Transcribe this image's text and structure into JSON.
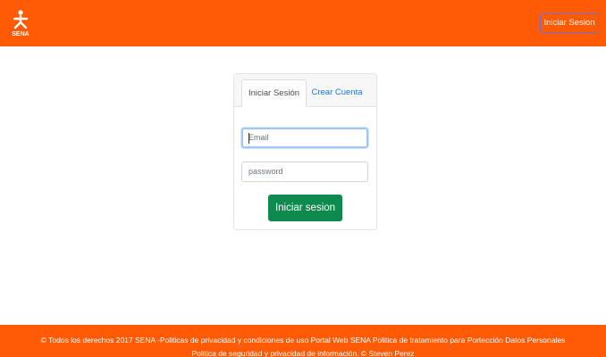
{
  "header": {
    "logo_text": "SENA",
    "login_button": "Iniciar Sesion"
  },
  "card": {
    "tabs": [
      {
        "label": "Iniciar Sesión",
        "active": true
      },
      {
        "label": "Crear Cuenta",
        "active": false
      }
    ],
    "email_placeholder": "Email",
    "password_placeholder": "password",
    "submit_label": "Iniciar sesion"
  },
  "footer": {
    "line1": "© Todos los derechos 2017 SENA -Politicas de privacidad y condiciones de uso Portal Web SENA Politica de tratamiento para Portección Datos Personales",
    "line2": "Politica de seguridad y privacidad de información. © Steven Perez"
  },
  "colors": {
    "brand": "#ff5a05",
    "submit": "#0e8a4e",
    "link": "#1a73d9"
  }
}
